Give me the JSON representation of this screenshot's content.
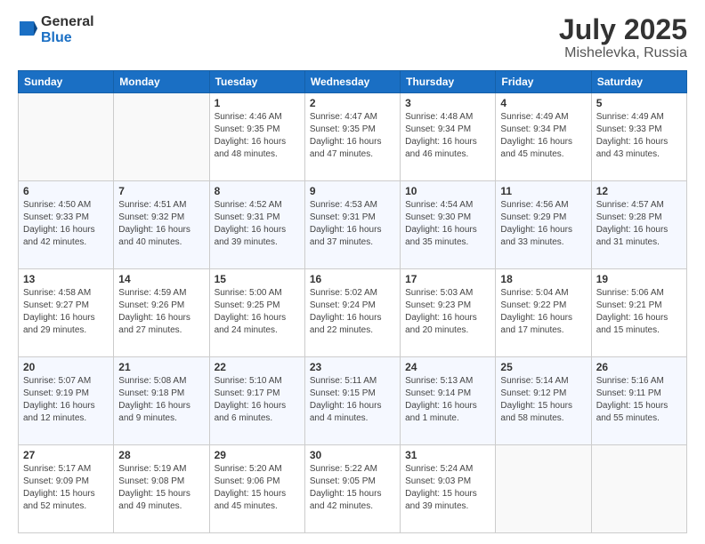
{
  "header": {
    "logo_general": "General",
    "logo_blue": "Blue",
    "main_title": "July 2025",
    "subtitle": "Mishelevka, Russia"
  },
  "calendar": {
    "headers": [
      "Sunday",
      "Monday",
      "Tuesday",
      "Wednesday",
      "Thursday",
      "Friday",
      "Saturday"
    ],
    "rows": [
      [
        {
          "day": "",
          "info": ""
        },
        {
          "day": "",
          "info": ""
        },
        {
          "day": "1",
          "info": "Sunrise: 4:46 AM\nSunset: 9:35 PM\nDaylight: 16 hours\nand 48 minutes."
        },
        {
          "day": "2",
          "info": "Sunrise: 4:47 AM\nSunset: 9:35 PM\nDaylight: 16 hours\nand 47 minutes."
        },
        {
          "day": "3",
          "info": "Sunrise: 4:48 AM\nSunset: 9:34 PM\nDaylight: 16 hours\nand 46 minutes."
        },
        {
          "day": "4",
          "info": "Sunrise: 4:49 AM\nSunset: 9:34 PM\nDaylight: 16 hours\nand 45 minutes."
        },
        {
          "day": "5",
          "info": "Sunrise: 4:49 AM\nSunset: 9:33 PM\nDaylight: 16 hours\nand 43 minutes."
        }
      ],
      [
        {
          "day": "6",
          "info": "Sunrise: 4:50 AM\nSunset: 9:33 PM\nDaylight: 16 hours\nand 42 minutes."
        },
        {
          "day": "7",
          "info": "Sunrise: 4:51 AM\nSunset: 9:32 PM\nDaylight: 16 hours\nand 40 minutes."
        },
        {
          "day": "8",
          "info": "Sunrise: 4:52 AM\nSunset: 9:31 PM\nDaylight: 16 hours\nand 39 minutes."
        },
        {
          "day": "9",
          "info": "Sunrise: 4:53 AM\nSunset: 9:31 PM\nDaylight: 16 hours\nand 37 minutes."
        },
        {
          "day": "10",
          "info": "Sunrise: 4:54 AM\nSunset: 9:30 PM\nDaylight: 16 hours\nand 35 minutes."
        },
        {
          "day": "11",
          "info": "Sunrise: 4:56 AM\nSunset: 9:29 PM\nDaylight: 16 hours\nand 33 minutes."
        },
        {
          "day": "12",
          "info": "Sunrise: 4:57 AM\nSunset: 9:28 PM\nDaylight: 16 hours\nand 31 minutes."
        }
      ],
      [
        {
          "day": "13",
          "info": "Sunrise: 4:58 AM\nSunset: 9:27 PM\nDaylight: 16 hours\nand 29 minutes."
        },
        {
          "day": "14",
          "info": "Sunrise: 4:59 AM\nSunset: 9:26 PM\nDaylight: 16 hours\nand 27 minutes."
        },
        {
          "day": "15",
          "info": "Sunrise: 5:00 AM\nSunset: 9:25 PM\nDaylight: 16 hours\nand 24 minutes."
        },
        {
          "day": "16",
          "info": "Sunrise: 5:02 AM\nSunset: 9:24 PM\nDaylight: 16 hours\nand 22 minutes."
        },
        {
          "day": "17",
          "info": "Sunrise: 5:03 AM\nSunset: 9:23 PM\nDaylight: 16 hours\nand 20 minutes."
        },
        {
          "day": "18",
          "info": "Sunrise: 5:04 AM\nSunset: 9:22 PM\nDaylight: 16 hours\nand 17 minutes."
        },
        {
          "day": "19",
          "info": "Sunrise: 5:06 AM\nSunset: 9:21 PM\nDaylight: 16 hours\nand 15 minutes."
        }
      ],
      [
        {
          "day": "20",
          "info": "Sunrise: 5:07 AM\nSunset: 9:19 PM\nDaylight: 16 hours\nand 12 minutes."
        },
        {
          "day": "21",
          "info": "Sunrise: 5:08 AM\nSunset: 9:18 PM\nDaylight: 16 hours\nand 9 minutes."
        },
        {
          "day": "22",
          "info": "Sunrise: 5:10 AM\nSunset: 9:17 PM\nDaylight: 16 hours\nand 6 minutes."
        },
        {
          "day": "23",
          "info": "Sunrise: 5:11 AM\nSunset: 9:15 PM\nDaylight: 16 hours\nand 4 minutes."
        },
        {
          "day": "24",
          "info": "Sunrise: 5:13 AM\nSunset: 9:14 PM\nDaylight: 16 hours\nand 1 minute."
        },
        {
          "day": "25",
          "info": "Sunrise: 5:14 AM\nSunset: 9:12 PM\nDaylight: 15 hours\nand 58 minutes."
        },
        {
          "day": "26",
          "info": "Sunrise: 5:16 AM\nSunset: 9:11 PM\nDaylight: 15 hours\nand 55 minutes."
        }
      ],
      [
        {
          "day": "27",
          "info": "Sunrise: 5:17 AM\nSunset: 9:09 PM\nDaylight: 15 hours\nand 52 minutes."
        },
        {
          "day": "28",
          "info": "Sunrise: 5:19 AM\nSunset: 9:08 PM\nDaylight: 15 hours\nand 49 minutes."
        },
        {
          "day": "29",
          "info": "Sunrise: 5:20 AM\nSunset: 9:06 PM\nDaylight: 15 hours\nand 45 minutes."
        },
        {
          "day": "30",
          "info": "Sunrise: 5:22 AM\nSunset: 9:05 PM\nDaylight: 15 hours\nand 42 minutes."
        },
        {
          "day": "31",
          "info": "Sunrise: 5:24 AM\nSunset: 9:03 PM\nDaylight: 15 hours\nand 39 minutes."
        },
        {
          "day": "",
          "info": ""
        },
        {
          "day": "",
          "info": ""
        }
      ]
    ]
  }
}
